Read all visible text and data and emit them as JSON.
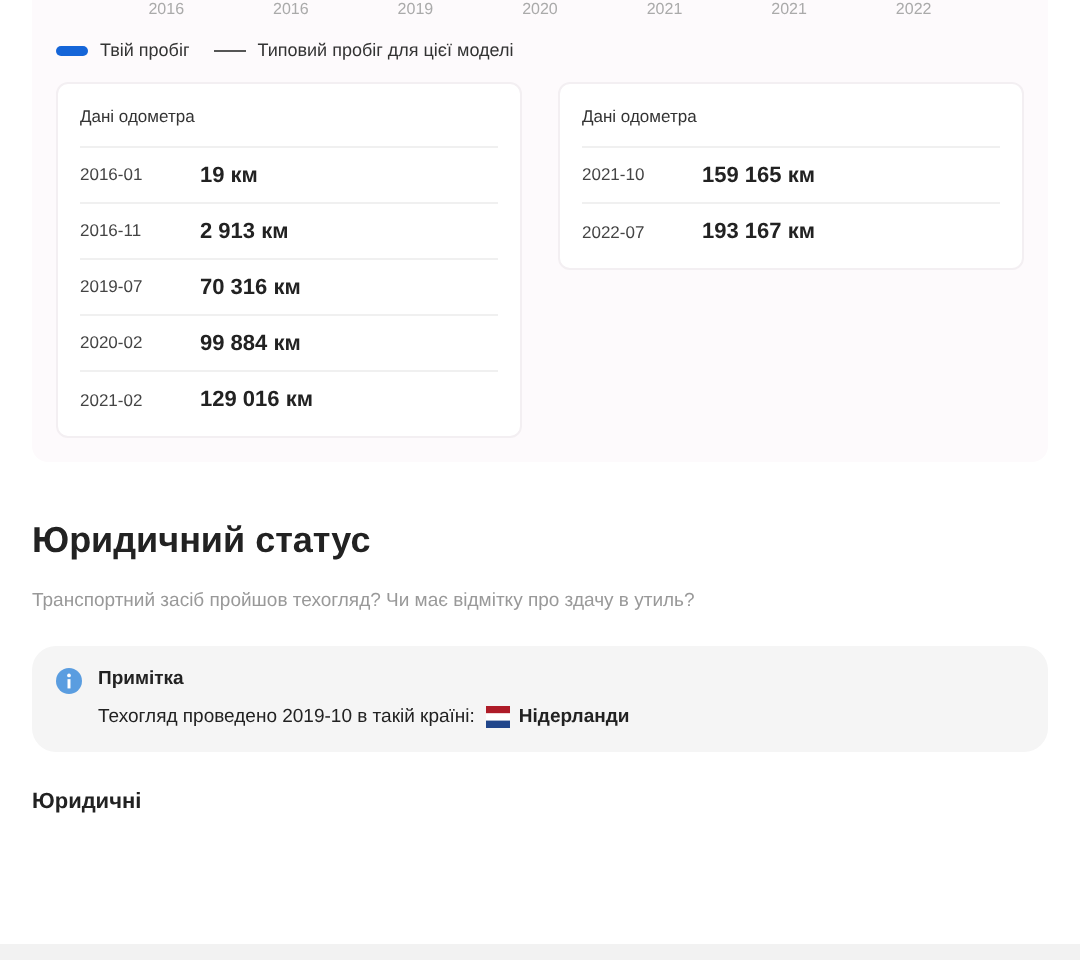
{
  "chart_axis": {
    "labels": [
      "2016",
      "2016",
      "2019",
      "2020",
      "2021",
      "2021",
      "2022"
    ]
  },
  "legend": [
    {
      "kind": "bar",
      "label": "Твій пробіг",
      "color": "#1565d8"
    },
    {
      "kind": "line",
      "label": "Типовий пробіг для цієї моделі",
      "color": "#555555"
    }
  ],
  "odometer_cards": [
    {
      "title": "Дані одометра",
      "rows": [
        {
          "date": "2016-01",
          "value": "19 км"
        },
        {
          "date": "2016-11",
          "value": "2 913 км"
        },
        {
          "date": "2019-07",
          "value": "70 316 км"
        },
        {
          "date": "2020-02",
          "value": "99 884 км"
        },
        {
          "date": "2021-02",
          "value": "129 016 км"
        }
      ]
    },
    {
      "title": "Дані одометра",
      "rows": [
        {
          "date": "2021-10",
          "value": "159 165 км"
        },
        {
          "date": "2022-07",
          "value": "193 167 км"
        }
      ]
    }
  ],
  "legal_status": {
    "title": "Юридичний статус",
    "subtitle": "Транспортний засіб пройшов техогляд? Чи має відмітку про здачу в утиль?",
    "note": {
      "title": "Примітка",
      "text": "Техогляд проведено 2019-10 в такій країні:",
      "country": "Нідерланди"
    },
    "section_title": "Юридичні"
  }
}
